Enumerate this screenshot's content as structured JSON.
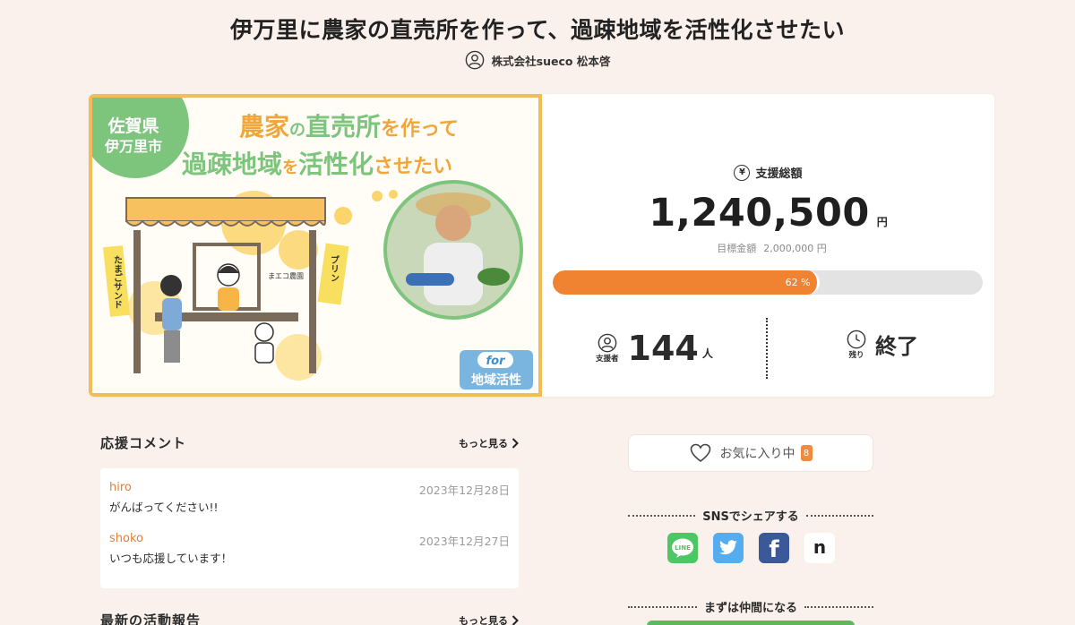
{
  "title": "伊万里に農家の直売所を作って、過疎地域を活性化させたい",
  "owner": {
    "name": "株式会社sueco 松本啓",
    "icon": "user-circle-icon"
  },
  "hero_image": {
    "badge_line1": "佐賀県",
    "badge_line2": "伊万里市",
    "headline_line1": [
      "農家",
      "の",
      "直売所",
      "を作って"
    ],
    "headline_line2": [
      "過疎地域",
      "を",
      "活性化",
      "させたい"
    ],
    "sign_left": "たまごサンド",
    "sign_right": "プリン",
    "shop_sign": "まエコ農園",
    "for_label": "for",
    "for_sub": "地域活性"
  },
  "funding": {
    "total_label": "支援総額",
    "total_icon": "yen-icon",
    "amount": "1,240,500",
    "currency": "円",
    "goal_label": "目標金額",
    "goal_amount": "2,000,000 円",
    "progress_percent": 62,
    "progress_text": "62 %",
    "supporters_label": "支援者",
    "supporters_count": "144",
    "supporters_unit": "人",
    "remaining_label": "残り",
    "remaining_value": "終了"
  },
  "comments": {
    "heading": "応援コメント",
    "more_label": "もっと見る",
    "items": [
      {
        "author": "hiro",
        "date": "2023年12月28日",
        "body": "がんばってください!!"
      },
      {
        "author": "shoko",
        "date": "2023年12月27日",
        "body": "いつも応援しています！"
      }
    ]
  },
  "reports": {
    "heading": "最新の活動報告",
    "more_label": "もっと見る"
  },
  "favorite": {
    "label": "お気に入り中",
    "count": "8",
    "icon": "heart-icon"
  },
  "share": {
    "heading": "SNSでシェアする",
    "items": [
      {
        "name": "LINE",
        "label": "LINE",
        "color": "#4cc764"
      },
      {
        "name": "Twitter",
        "color": "#55acee"
      },
      {
        "name": "Facebook",
        "label": "f",
        "color": "#3b5998"
      },
      {
        "name": "note",
        "label": "n",
        "color": "#ffffff"
      }
    ]
  },
  "join": {
    "heading": "まずは仲間になる"
  },
  "colors": {
    "accent": "#ef8332",
    "background": "#fbf1ec",
    "green": "#7dc47c",
    "yellow": "#f2bd56"
  }
}
